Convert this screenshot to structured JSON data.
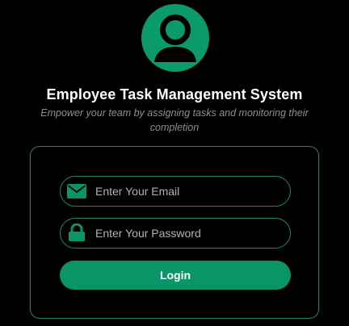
{
  "header": {
    "avatar_icon": "user-avatar-icon",
    "title": "Employee Task Management System",
    "subtitle": "Empower your team by assigning tasks and monitoring their completion"
  },
  "form": {
    "email": {
      "icon": "envelope-icon",
      "placeholder": "Enter Your Email",
      "value": ""
    },
    "password": {
      "icon": "lock-icon",
      "placeholder": "Enter Your Password",
      "value": ""
    },
    "login_label": "Login"
  },
  "colors": {
    "background": "#000000",
    "accent": "#0a9568",
    "border": "#1f8a5a",
    "title": "#ffffff",
    "subtitle": "#8e8e8e"
  }
}
